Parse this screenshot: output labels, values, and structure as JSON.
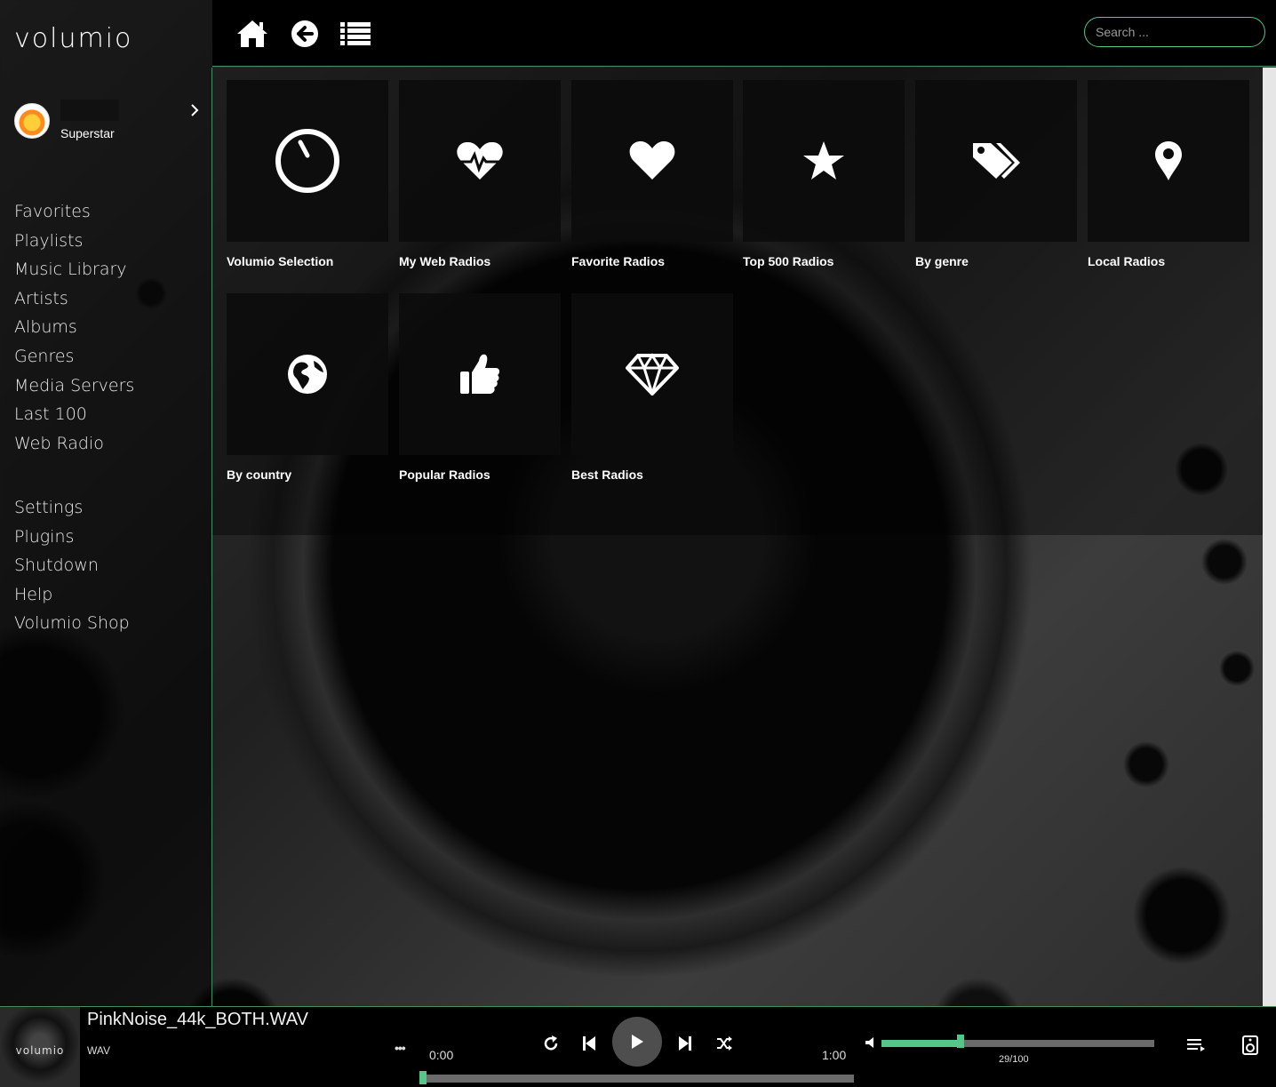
{
  "app": {
    "logo_text": "volumio",
    "accent_color": "#54c688"
  },
  "user": {
    "status": "Superstar",
    "avatar_icon": "avatar-image"
  },
  "sidebar": {
    "primary": [
      {
        "label": "Favorites"
      },
      {
        "label": "Playlists"
      },
      {
        "label": "Music Library"
      },
      {
        "label": "Artists"
      },
      {
        "label": "Albums"
      },
      {
        "label": "Genres"
      },
      {
        "label": "Media Servers"
      },
      {
        "label": "Last 100"
      },
      {
        "label": "Web Radio"
      }
    ],
    "secondary": [
      {
        "label": "Settings"
      },
      {
        "label": "Plugins"
      },
      {
        "label": "Shutdown"
      },
      {
        "label": "Help"
      },
      {
        "label": "Volumio Shop"
      }
    ]
  },
  "topbar": {
    "home_icon": "home-icon",
    "back_icon": "back-arrow-icon",
    "queue_icon": "list-icon",
    "search_placeholder": "Search ..."
  },
  "tiles": [
    {
      "label": "Volumio Selection",
      "icon": "dial-icon"
    },
    {
      "label": "My Web Radios",
      "icon": "heartbeat-icon"
    },
    {
      "label": "Favorite Radios",
      "icon": "heart-icon"
    },
    {
      "label": "Top 500 Radios",
      "icon": "star-icon"
    },
    {
      "label": "By genre",
      "icon": "tags-icon"
    },
    {
      "label": "Local Radios",
      "icon": "map-marker-icon"
    },
    {
      "label": "By country",
      "icon": "globe-icon"
    },
    {
      "label": "Popular Radios",
      "icon": "thumbs-up-icon"
    },
    {
      "label": "Best Radios",
      "icon": "diamond-icon"
    }
  ],
  "player": {
    "album_art_text": "volumio",
    "track_title": "PinkNoise_44k_BOTH.WAV",
    "format": "WAV",
    "more_label": "•••",
    "time_elapsed": "0:00",
    "time_total": "1:00",
    "seek_fraction": 0.0,
    "volume_value": 29,
    "volume_readout": "29/100"
  }
}
